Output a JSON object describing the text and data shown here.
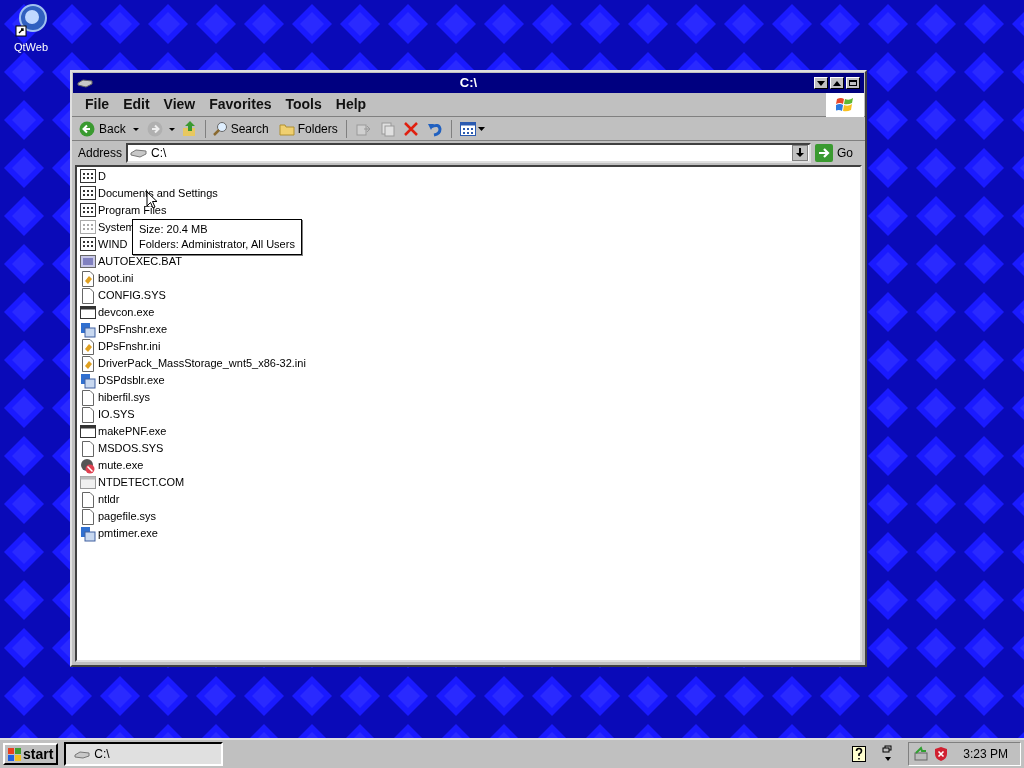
{
  "desktop_icons": [
    {
      "label": "QtWeb"
    }
  ],
  "window": {
    "title": "C:\\"
  },
  "menu": [
    "File",
    "Edit",
    "View",
    "Favorites",
    "Tools",
    "Help"
  ],
  "toolbar": {
    "back": "Back",
    "search": "Search",
    "folders": "Folders"
  },
  "address": {
    "label": "Address",
    "value": "C:\\",
    "go": "Go"
  },
  "files": [
    {
      "name": "D",
      "kind": "folder"
    },
    {
      "name": "Documents and Settings",
      "kind": "folder"
    },
    {
      "name": "Program Files",
      "kind": "folder"
    },
    {
      "name": "System",
      "kind": "folder-dim"
    },
    {
      "name": "WIND",
      "kind": "folder"
    },
    {
      "name": "AUTOEXEC.BAT",
      "kind": "bat"
    },
    {
      "name": "boot.ini",
      "kind": "ini"
    },
    {
      "name": "CONFIG.SYS",
      "kind": "file"
    },
    {
      "name": "devcon.exe",
      "kind": "window"
    },
    {
      "name": "DPsFnshr.exe",
      "kind": "setup"
    },
    {
      "name": "DPsFnshr.ini",
      "kind": "ini"
    },
    {
      "name": "DriverPack_MassStorage_wnt5_x86-32.ini",
      "kind": "ini"
    },
    {
      "name": "DSPdsblr.exe",
      "kind": "setup"
    },
    {
      "name": "hiberfil.sys",
      "kind": "file"
    },
    {
      "name": "IO.SYS",
      "kind": "file"
    },
    {
      "name": "makePNF.exe",
      "kind": "window"
    },
    {
      "name": "MSDOS.SYS",
      "kind": "file"
    },
    {
      "name": "mute.exe",
      "kind": "mute"
    },
    {
      "name": "NTDETECT.COM",
      "kind": "com"
    },
    {
      "name": "ntldr",
      "kind": "file"
    },
    {
      "name": "pagefile.sys",
      "kind": "file"
    },
    {
      "name": "pmtimer.exe",
      "kind": "setup"
    }
  ],
  "tooltip": [
    "Size: 20.4 MB",
    "Folders: Administrator, All Users"
  ],
  "taskbar": {
    "start": "start",
    "task": "C:\\",
    "clock": "3:23 PM"
  }
}
